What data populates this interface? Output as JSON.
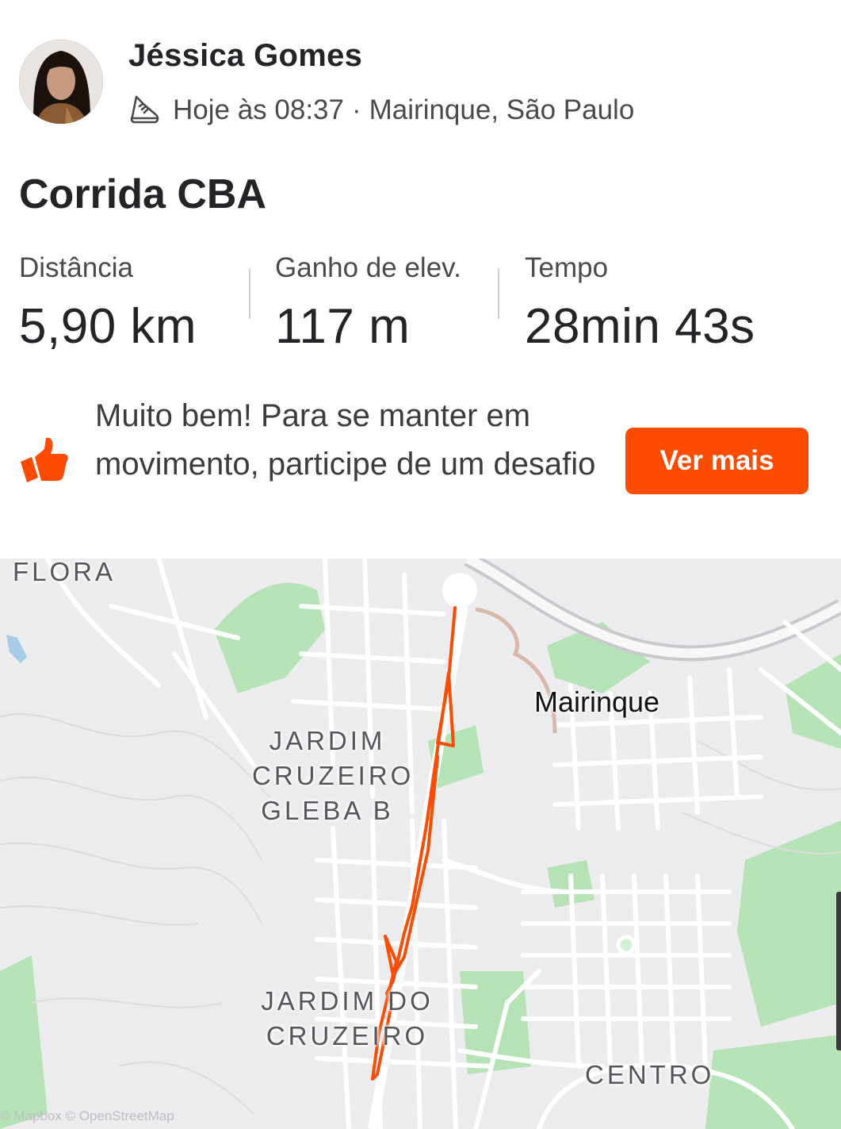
{
  "athlete": {
    "name": "Jéssica Gomes",
    "time": "Hoje às 08:37",
    "separator": "·",
    "location": "Mairinque, São Paulo",
    "activity_icon": "running-shoe-icon"
  },
  "activity": {
    "title": "Corrida CBA",
    "stats": [
      {
        "label": "Distância",
        "value": "5,90 km"
      },
      {
        "label": "Ganho de elev.",
        "value": "117 m"
      },
      {
        "label": "Tempo",
        "value": "28min 43s"
      }
    ]
  },
  "nudge": {
    "icon": "thumbs-up-icon",
    "text": "Muito bem! Para se manter em movimento, participe de um desafio",
    "button_label": "Ver mais"
  },
  "map": {
    "labels": {
      "flora": "FLORA",
      "gleba": [
        "JARDIM",
        "CRUZEIRO",
        "GLEBA B"
      ],
      "town": "Mairinque",
      "jardim_do": [
        "JARDIM DO",
        "CRUZEIRO"
      ],
      "centro": "CENTRO"
    },
    "attribution": "© Mapbox © OpenStreetMap",
    "route_color": "#fc4c02",
    "park_color": "#a8e0a8",
    "water_color": "#a6cde8"
  }
}
